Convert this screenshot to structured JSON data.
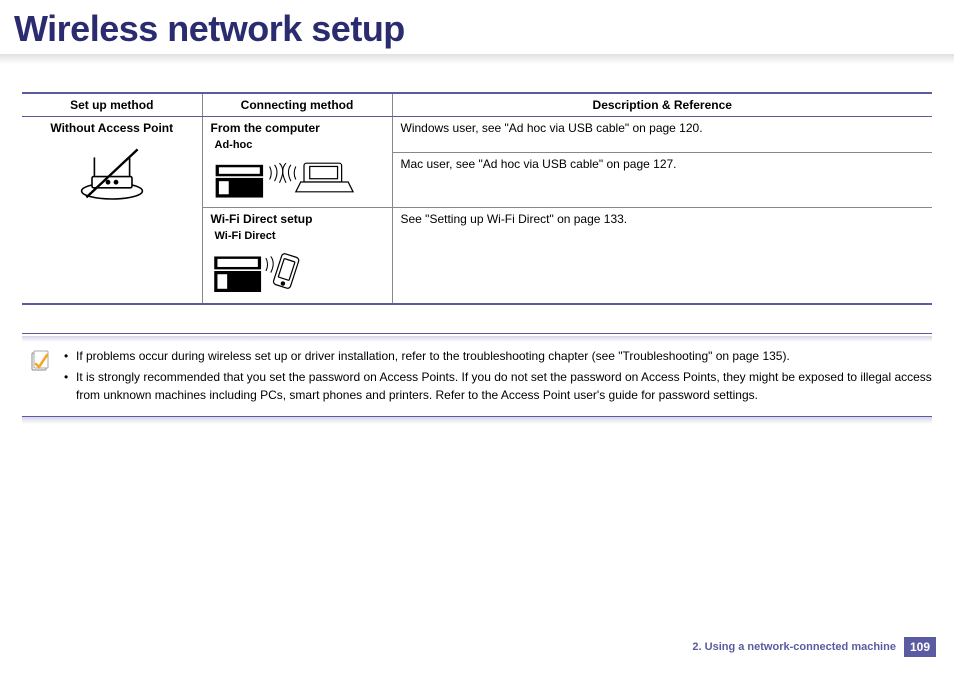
{
  "title": "Wireless network setup",
  "table": {
    "headers": [
      "Set up method",
      "Connecting method",
      "Description & Reference"
    ],
    "setup_method": "Without Access Point",
    "rows": [
      {
        "method": "From the computer",
        "sublabel": "Ad-hoc",
        "desc_lines": [
          "Windows user, see \"Ad hoc via USB cable\" on page 120.",
          "Mac user, see \"Ad hoc via USB cable\" on page 127."
        ]
      },
      {
        "method": "Wi-Fi Direct setup",
        "sublabel": "Wi-Fi Direct",
        "desc_lines": [
          "See \"Setting up Wi-Fi Direct\" on page 133."
        ]
      }
    ]
  },
  "notes": [
    "If problems occur during wireless set up or driver installation, refer to the troubleshooting chapter (see \"Troubleshooting\" on page 135).",
    "It is strongly recommended that you set the password on Access Points. If you do not set the password on Access Points, they might be exposed to illegal access from unknown machines including PCs, smart phones and printers. Refer to the Access Point user's guide for password settings."
  ],
  "footer": {
    "chapter": "2.  Using a network-connected machine",
    "page": "109"
  }
}
